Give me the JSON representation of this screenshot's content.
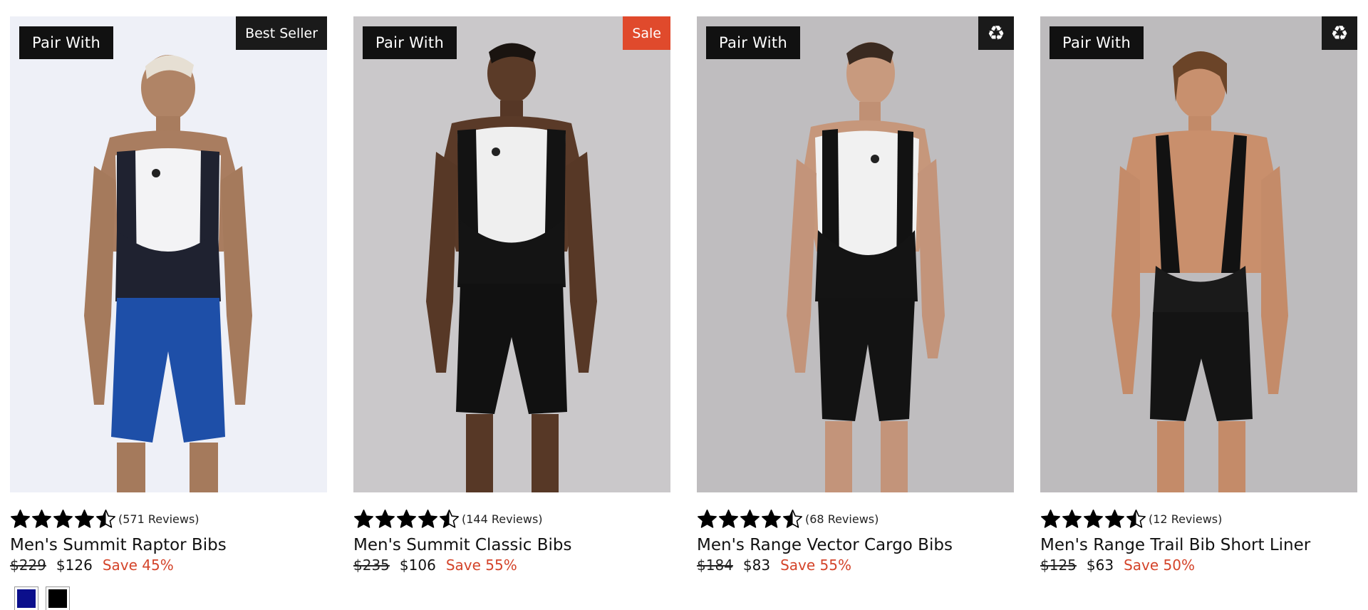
{
  "products": [
    {
      "pair_label": "Pair With",
      "badge": "Best Seller",
      "badge_type": "text",
      "rating": 4.5,
      "reviews": "(571 Reviews)",
      "title": "Men's Summit Raptor Bibs",
      "price_old": "$229",
      "price_new": "$126",
      "save": "Save 45%",
      "background": "#eef0f7",
      "shorts_color": "#1e4fa8",
      "swatches": [
        "#0b0f8c",
        "#000000"
      ]
    },
    {
      "pair_label": "Pair With",
      "badge": "Sale",
      "badge_type": "sale",
      "rating": 4.5,
      "reviews": "(144 Reviews)",
      "title": "Men's Summit Classic Bibs",
      "price_old": "$235",
      "price_new": "$106",
      "save": "Save 55%",
      "background": "#cac8ca",
      "shorts_color": "#111111",
      "swatches": []
    },
    {
      "pair_label": "Pair With",
      "badge": "♻",
      "badge_type": "eco",
      "badge_icon": "recycle-icon",
      "rating": 4.5,
      "reviews": "(68 Reviews)",
      "title": "Men's Range Vector Cargo Bibs",
      "price_old": "$184",
      "price_new": "$83",
      "save": "Save 55%",
      "background": "#bfbdbf",
      "shorts_color": "#131313",
      "swatches": []
    },
    {
      "pair_label": "Pair With",
      "badge": "♻",
      "badge_type": "eco",
      "badge_icon": "recycle-icon",
      "rating": 4.5,
      "reviews": "(12 Reviews)",
      "title": "Men's Range Trail Bib Short Liner",
      "price_old": "$125",
      "price_new": "$63",
      "save": "Save 50%",
      "background": "#bdbbbd",
      "shorts_color": "#141414",
      "swatches": []
    }
  ],
  "colors": {
    "accent_sale": "#d4442a",
    "badge_dark": "#1a1a1a",
    "sale_badge": "#e04a2c"
  }
}
